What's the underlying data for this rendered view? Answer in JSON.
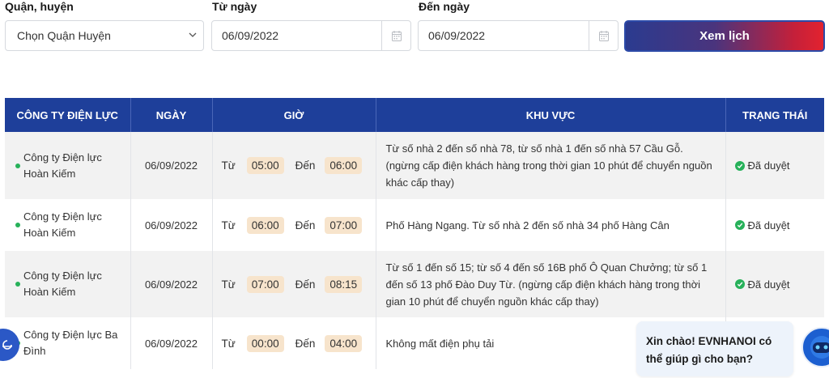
{
  "filters": {
    "district_label": "Quận, huyện",
    "district_value": "Chọn Quận Huyện",
    "from_label": "Từ ngày",
    "from_value": "06/09/2022",
    "to_label": "Đến ngày",
    "to_value": "06/09/2022",
    "submit_label": "Xem lịch"
  },
  "table": {
    "headers": {
      "company": "CÔNG TY ĐIỆN LỰC",
      "date": "NGÀY",
      "time": "GIỜ",
      "area": "KHU VỰC",
      "status": "TRẠNG THÁI"
    },
    "from_word": "Từ",
    "to_word": "Đến",
    "rows": [
      {
        "company": "Công ty Điện lực Hoàn Kiếm",
        "date": "06/09/2022",
        "start": "05:00",
        "end": "06:00",
        "area": "Từ số nhà 2 đến số nhà 78, từ số nhà 1 đến số nhà 57 Cầu Gỗ. (ngừng cấp điện khách hàng trong thời gian 10 phút để chuyển nguồn khác cấp thay)",
        "status": "Đã duyệt"
      },
      {
        "company": "Công ty Điện lực Hoàn Kiếm",
        "date": "06/09/2022",
        "start": "06:00",
        "end": "07:00",
        "area": "Phố Hàng Ngang. Từ số nhà 2 đến số nhà 34 phố Hàng Cân",
        "status": "Đã duyệt"
      },
      {
        "company": "Công ty Điện lực Hoàn Kiếm",
        "date": "06/09/2022",
        "start": "07:00",
        "end": "08:15",
        "area": "Từ số 1 đến số 15; từ số 4 đến số 16B phố Ô Quan Chưởng; từ số 1 đến số 13 phố Đào Duy Từ. (ngừng cấp điện khách hàng trong thời gian 10 phút để chuyển nguồn khác cấp thay)",
        "status": "Đã duyệt"
      },
      {
        "company": "Công ty Điện lực Ba Đình",
        "date": "06/09/2022",
        "start": "00:00",
        "end": "04:00",
        "area": "Không mất điện phụ tải",
        "status": ""
      }
    ]
  },
  "chat": {
    "greeting": "Xin chào! EVNHANOI có thể giúp gì cho bạn?"
  },
  "icons": {
    "chevron": "chevron-down-icon",
    "calendar": "calendar-icon",
    "check": "check-circle-icon",
    "bot": "chatbot-avatar-icon"
  },
  "colors": {
    "header_bg": "#1e3f9a",
    "date_red": "#d0202a",
    "status_green": "#27b15a",
    "time_pill": "#f7e4cc"
  }
}
